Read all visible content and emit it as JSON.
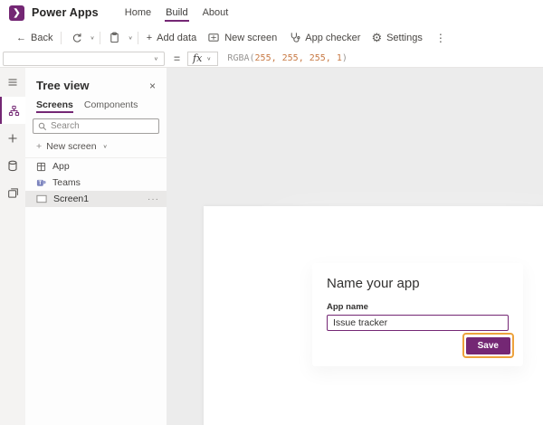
{
  "colors": {
    "brand": "#742774",
    "highlight_ring": "#eda23c",
    "formula_number": "#c87a45",
    "workspace_bg": "#ececec"
  },
  "icons": {
    "logo": "❯",
    "back": "←",
    "chevron_down": "∨",
    "more_vertical": "⋮",
    "row_more": "···",
    "close": "×",
    "gear": "⚙",
    "plus": "+",
    "equals": "="
  },
  "topbar": {
    "brand": "Power Apps",
    "nav": [
      {
        "label": "Home"
      },
      {
        "label": "Build"
      },
      {
        "label": "About"
      }
    ]
  },
  "toolbar": {
    "back": "Back",
    "add_data": "Add data",
    "new_screen": "New screen",
    "app_checker": "App checker",
    "settings": "Settings"
  },
  "formula_bar": {
    "property_value": "",
    "fx_label": "fx",
    "formula_prefix": "RGBA(",
    "formula_numbers": "255, 255, 255, 1",
    "formula_suffix": ")"
  },
  "left_rail": {
    "icons": [
      "menu-icon",
      "tree-view-icon",
      "insert-plus-icon",
      "data-icon",
      "media-icon"
    ],
    "active_index": 1
  },
  "tree_panel": {
    "title": "Tree view",
    "tabs": [
      {
        "label": "Screens",
        "active": true
      },
      {
        "label": "Components",
        "active": false
      }
    ],
    "search_placeholder": "Search",
    "new_screen": "New screen",
    "items": [
      {
        "label": "App",
        "icon": "app-icon"
      },
      {
        "label": "Teams",
        "icon": "teams-icon"
      },
      {
        "label": "Screen1",
        "icon": "screen-icon",
        "selected": true
      }
    ]
  },
  "dialog": {
    "title": "Name your app",
    "app_name_label": "App name",
    "app_name_value": "Issue tracker",
    "save": "Save"
  }
}
